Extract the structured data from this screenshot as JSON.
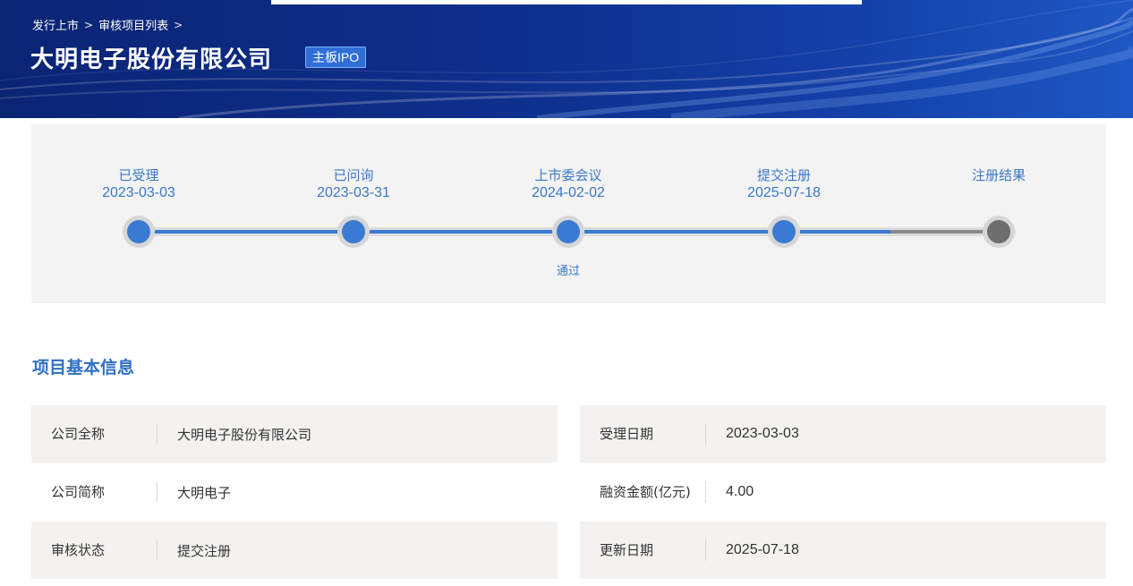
{
  "header": {
    "breadcrumb": [
      "发行上市",
      "审核项目列表"
    ],
    "breadcrumb_separator": ">",
    "company_name": "大明电子股份有限公司",
    "board_badge": "主板IPO"
  },
  "progress": {
    "steps": [
      {
        "label": "已受理",
        "date": "2023-03-03",
        "status": "done"
      },
      {
        "label": "已问询",
        "date": "2023-03-31",
        "status": "done"
      },
      {
        "label": "上市委会议",
        "date": "2024-02-02",
        "status": "done",
        "note": "通过"
      },
      {
        "label": "提交注册",
        "date": "2025-07-18",
        "status": "current"
      },
      {
        "label": "注册结果",
        "date": "",
        "status": "pending"
      }
    ]
  },
  "basic_info": {
    "title": "项目基本信息",
    "left": [
      {
        "label": "公司全称",
        "value": "大明电子股份有限公司"
      },
      {
        "label": "公司简称",
        "value": "大明电子"
      },
      {
        "label": "审核状态",
        "value": "提交注册"
      }
    ],
    "right": [
      {
        "label": "受理日期",
        "value": "2023-03-03"
      },
      {
        "label": "融资金额(亿元)",
        "value": "4.00"
      },
      {
        "label": "更新日期",
        "value": "2025-07-18"
      }
    ]
  },
  "colors": {
    "banner": "#0e2f8c",
    "accent": "#3a7ad2",
    "pending": "#6e6e6e",
    "panel": "#f3f3f3"
  }
}
